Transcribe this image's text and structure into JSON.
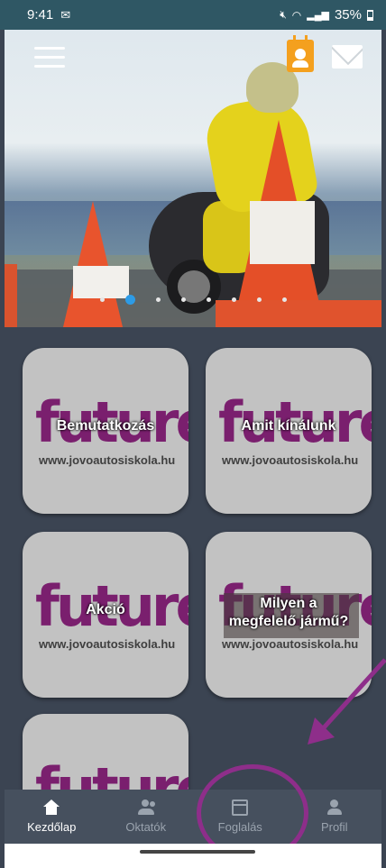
{
  "status_bar": {
    "time": "9:41",
    "battery": "35%"
  },
  "hero": {
    "carousel_active_index": 1,
    "carousel_count": 8
  },
  "tiles": [
    {
      "label": "Bemutatkozás",
      "logo_word": "future",
      "url": "www.jovoautosiskola.hu"
    },
    {
      "label": "Amit kínálunk",
      "logo_word": "future",
      "url": "www.jovoautosiskola.hu"
    },
    {
      "label": "Akció",
      "logo_word": "future",
      "url": "www.jovoautosiskola.hu"
    },
    {
      "label_line1": "Milyen a",
      "label_line2": "megfelelő jármű?",
      "logo_word": "future",
      "url": "www.jovoautosiskola.hu"
    },
    {
      "label": "",
      "logo_word": "future",
      "url": ""
    }
  ],
  "bottom_nav": {
    "items": [
      {
        "label": "Kezdőlap",
        "icon": "home-icon",
        "active": true
      },
      {
        "label": "Oktatók",
        "icon": "people-icon",
        "active": false
      },
      {
        "label": "Foglalás",
        "icon": "calendar-icon",
        "active": false
      },
      {
        "label": "Profil",
        "icon": "person-icon",
        "active": false
      }
    ]
  },
  "colors": {
    "status_bar": "#2f5764",
    "background": "#3b4452",
    "nav_bar": "#46505e",
    "accent_dot": "#2d9be6",
    "brand_purple": "#7a1f6e",
    "annotation": "#8e2e8a",
    "calendar_orange": "#f4a01e"
  }
}
